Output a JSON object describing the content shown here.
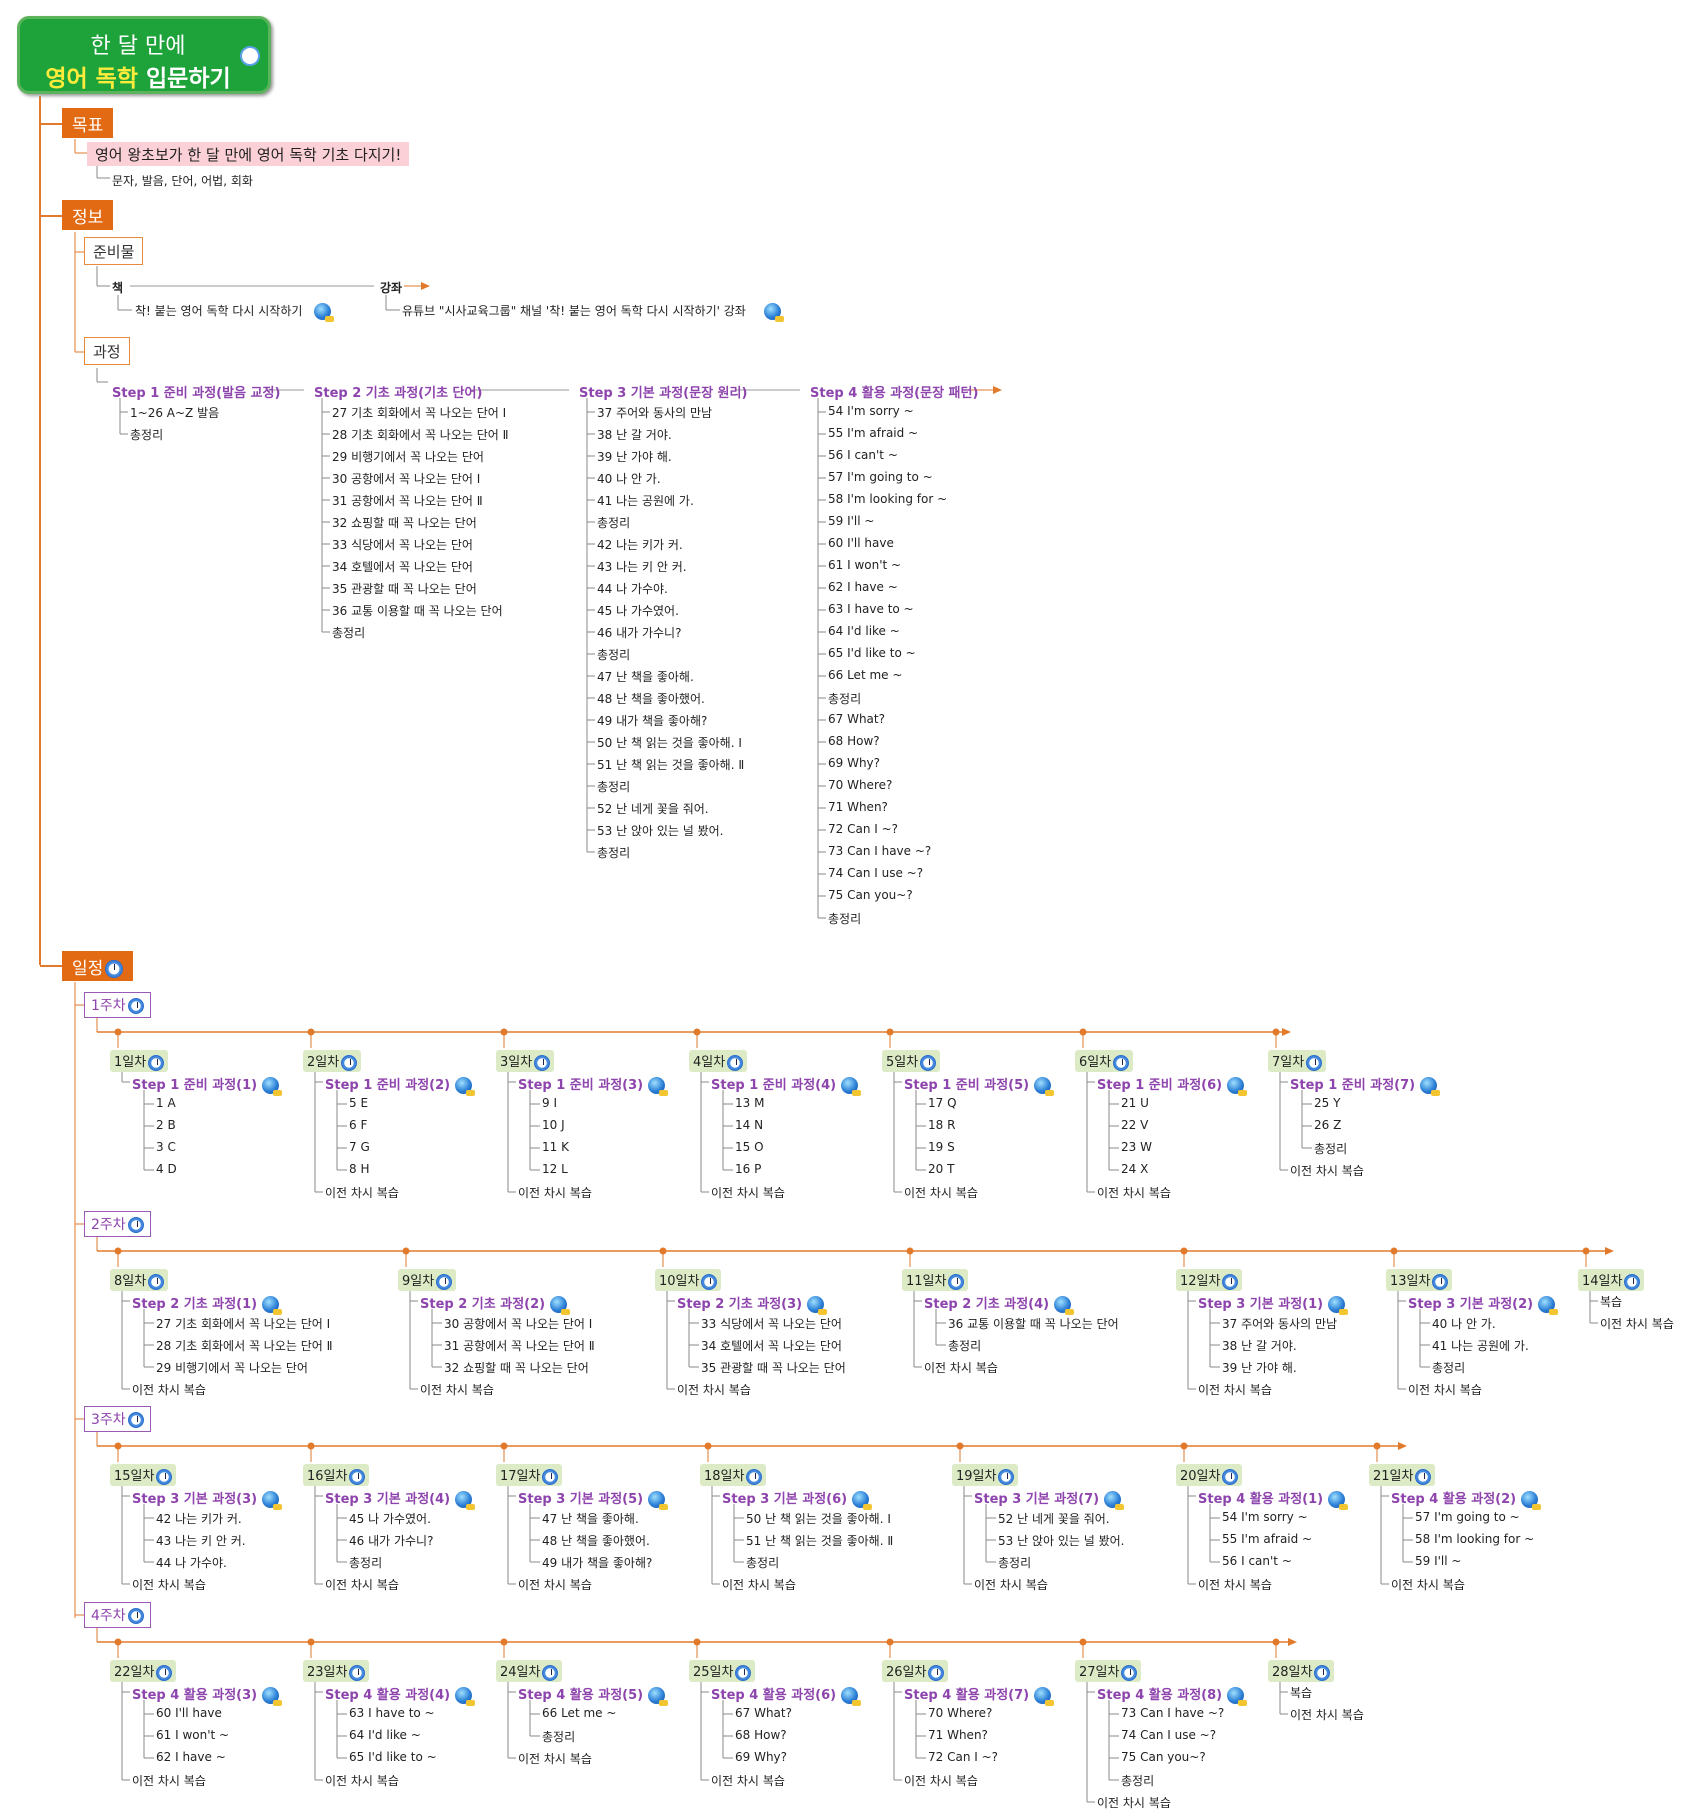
{
  "title": {
    "line1": "한 달 만에",
    "line2a": "영어 독학",
    "line2b": "입문하기"
  },
  "goal": {
    "label": "목표",
    "text": "영어 왕초보가 한 달 만에 영어 독학 기초 다지기!",
    "detail": "문자, 발음, 단어, 어법, 회화"
  },
  "info": {
    "label": "정보",
    "materials": {
      "label": "준비물",
      "book": "책",
      "book_title": "착! 붙는 영어 독학 다시 시작하기",
      "lecture": "강좌",
      "lecture_text": "유튜브 \"시사교육그룹\" 채널 '착! 붙는 영어 독학 다시 시작하기' 강좌"
    },
    "course": {
      "label": "과정",
      "steps": [
        {
          "title": "Step 1 준비 과정(발음 교정)",
          "items": [
            "1~26 A~Z 발음",
            "총정리"
          ]
        },
        {
          "title": "Step 2 기초 과정(기초 단어)",
          "items": [
            "27 기초 회화에서 꼭 나오는 단어 Ⅰ",
            "28 기초 회화에서 꼭 나오는 단어 Ⅱ",
            "29 비행기에서 꼭 나오는 단어",
            "30 공항에서 꼭 나오는 단어 Ⅰ",
            "31 공항에서 꼭 나오는 단어 Ⅱ",
            "32 쇼핑할 때 꼭 나오는 단어",
            "33 식당에서 꼭 나오는 단어",
            "34 호텔에서 꼭 나오는 단어",
            "35 관광할 때 꼭 나오는 단어",
            "36 교통 이용할 때 꼭 나오는 단어",
            "총정리"
          ]
        },
        {
          "title": "Step 3 기본 과정(문장 원리)",
          "items": [
            "37 주어와 동사의 만남",
            "38 난 갈 거야.",
            "39 난 가야 해.",
            "40 나 안 가.",
            "41 나는 공원에 가.",
            "총정리",
            "42 나는 키가 커.",
            "43 나는 키 안 커.",
            "44 나 가수야.",
            "45 나 가수였어.",
            "46 내가 가수니?",
            "총정리",
            "47 난 책을 좋아해.",
            "48 난 책을 좋아했어.",
            "49 내가 책을 좋아해?",
            "50 난 책 읽는 것을 좋아해. Ⅰ",
            "51 난 책 읽는 것을 좋아해. Ⅱ",
            "총정리",
            "52 난 네게 꽃을 줘어.",
            "53 난 앉아 있는 널 봤어.",
            "총정리"
          ]
        },
        {
          "title": "Step 4 활용 과정(문장 패턴)",
          "items": [
            "54 I'm sorry ~",
            "55 I'm afraid ~",
            "56 I can't ~",
            "57 I'm going to ~",
            "58 I'm looking for ~",
            "59 I'll ~",
            "60 I'll have",
            "61 I won't ~",
            "62 I have ~",
            "63 I have to ~",
            "64 I'd like ~",
            "65 I'd like to ~",
            "66 Let me ~",
            "총정리",
            "67 What?",
            "68 How?",
            "69 Why?",
            "70 Where?",
            "71 When?",
            "72 Can I ~?",
            "73 Can I have ~?",
            "74 Can I use ~?",
            "75 Can you~?",
            "총정리"
          ]
        }
      ]
    }
  },
  "schedule": {
    "label": "일정",
    "weeks": [
      {
        "label": "1주차",
        "days": [
          {
            "label": "1일차",
            "step": "Step 1 준비 과정(1)",
            "items": [
              "1 A",
              "2 B",
              "3 C",
              "4 D"
            ]
          },
          {
            "label": "2일차",
            "step": "Step 1 준비 과정(2)",
            "items": [
              "5 E",
              "6 F",
              "7 G",
              "8 H"
            ],
            "review": "이전 차시 복습"
          },
          {
            "label": "3일차",
            "step": "Step 1 준비 과정(3)",
            "items": [
              "9 I",
              "10 J",
              "11 K",
              "12 L"
            ],
            "review": "이전 차시 복습"
          },
          {
            "label": "4일차",
            "step": "Step 1 준비 과정(4)",
            "items": [
              "13 M",
              "14 N",
              "15 O",
              "16 P"
            ],
            "review": "이전 차시 복습"
          },
          {
            "label": "5일차",
            "step": "Step 1 준비 과정(5)",
            "items": [
              "17 Q",
              "18 R",
              "19 S",
              "20 T"
            ],
            "review": "이전 차시 복습"
          },
          {
            "label": "6일차",
            "step": "Step 1 준비 과정(6)",
            "items": [
              "21 U",
              "22 V",
              "23 W",
              "24 X"
            ],
            "review": "이전 차시 복습"
          },
          {
            "label": "7일차",
            "step": "Step 1 준비 과정(7)",
            "items": [
              "25 Y",
              "26 Z",
              "총정리"
            ],
            "review": "이전 차시 복습"
          }
        ]
      },
      {
        "label": "2주차",
        "days": [
          {
            "label": "8일차",
            "step": "Step 2 기초 과정(1)",
            "items": [
              "27 기초 회화에서 꼭 나오는 단어 Ⅰ",
              "28 기초 회화에서 꼭 나오는 단어 Ⅱ",
              "29 비행기에서 꼭 나오는 단어"
            ],
            "review": "이전 차시 복습"
          },
          {
            "label": "9일차",
            "step": "Step 2 기초 과정(2)",
            "items": [
              "30 공항에서 꼭 나오는 단어 Ⅰ",
              "31 공항에서 꼭 나오는 단어 Ⅱ",
              "32 쇼핑할 때 꼭 나오는 단어"
            ],
            "review": "이전 차시 복습"
          },
          {
            "label": "10일차",
            "step": "Step 2 기초 과정(3)",
            "items": [
              "33 식당에서 꼭 나오는 단어",
              "34 호텔에서 꼭 나오는 단어",
              "35 관광할 때 꼭 나오는 단어"
            ],
            "review": "이전 차시 복습"
          },
          {
            "label": "11일차",
            "step": "Step 2 기초 과정(4)",
            "items": [
              "36 교통 이용할 때 꼭 나오는 단어",
              "총정리"
            ],
            "review": "이전 차시 복습"
          },
          {
            "label": "12일차",
            "step": "Step 3 기본 과정(1)",
            "items": [
              "37 주어와 동사의 만남",
              "38 난 갈 거야.",
              "39 난 가야 해."
            ],
            "review": "이전 차시 복습"
          },
          {
            "label": "13일차",
            "step": "Step 3 기본 과정(2)",
            "items": [
              "40 나 안 가.",
              "41 나는 공원에 가.",
              "총정리"
            ],
            "review": "이전 차시 복습"
          },
          {
            "label": "14일차",
            "plain": [
              "복습",
              "이전 차시 복습"
            ]
          }
        ]
      },
      {
        "label": "3주차",
        "days": [
          {
            "label": "15일차",
            "step": "Step 3 기본 과정(3)",
            "items": [
              "42 나는 키가 커.",
              "43 나는 키 안 커.",
              "44 나 가수야."
            ],
            "review": "이전 차시 복습"
          },
          {
            "label": "16일차",
            "step": "Step 3 기본 과정(4)",
            "items": [
              "45 나 가수였어.",
              "46 내가 가수니?",
              "총정리"
            ],
            "review": "이전 차시 복습"
          },
          {
            "label": "17일차",
            "step": "Step 3 기본 과정(5)",
            "items": [
              "47 난 책을 좋아해.",
              "48 난 책을 좋아했어.",
              "49 내가 책을 좋아해?"
            ],
            "review": "이전 차시 복습"
          },
          {
            "label": "18일차",
            "step": "Step 3 기본 과정(6)",
            "items": [
              "50 난 책 읽는 것을 좋아해. Ⅰ",
              "51 난 책 읽는 것을 좋아해. Ⅱ",
              "총정리"
            ],
            "review": "이전 차시 복습"
          },
          {
            "label": "19일차",
            "step": "Step 3 기본 과정(7)",
            "items": [
              "52 난 네게 꽃을 줘어.",
              "53 난 앉아 있는 널 봤어.",
              "총정리"
            ],
            "review": "이전 차시 복습"
          },
          {
            "label": "20일차",
            "step": "Step 4 활용 과정(1)",
            "items": [
              "54 I'm sorry ~",
              "55 I'm afraid ~",
              "56 I can't ~"
            ],
            "review": "이전 차시 복습"
          },
          {
            "label": "21일차",
            "step": "Step 4 활용 과정(2)",
            "items": [
              "57 I'm going to ~",
              "58 I'm looking for ~",
              "59 I'll ~"
            ],
            "review": "이전 차시 복습"
          }
        ]
      },
      {
        "label": "4주차",
        "days": [
          {
            "label": "22일차",
            "step": "Step 4 활용 과정(3)",
            "items": [
              "60 I'll have",
              "61 I won't ~",
              "62 I have ~"
            ],
            "review": "이전 차시 복습"
          },
          {
            "label": "23일차",
            "step": "Step 4 활용 과정(4)",
            "items": [
              "63 I have to ~",
              "64 I'd like ~",
              "65 I'd like to ~"
            ],
            "review": "이전 차시 복습"
          },
          {
            "label": "24일차",
            "step": "Step 4 활용 과정(5)",
            "items": [
              "66 Let me ~",
              "총정리"
            ],
            "review": "이전 차시 복습"
          },
          {
            "label": "25일차",
            "step": "Step 4 활용 과정(6)",
            "items": [
              "67 What?",
              "68 How?",
              "69 Why?"
            ],
            "review": "이전 차시 복습"
          },
          {
            "label": "26일차",
            "step": "Step 4 활용 과정(7)",
            "items": [
              "70 Where?",
              "71 When?",
              "72 Can I ~?"
            ],
            "review": "이전 차시 복습"
          },
          {
            "label": "27일차",
            "step": "Step 4 활용 과정(8)",
            "items": [
              "73 Can I have ~?",
              "74 Can I use ~?",
              "75 Can you~?",
              "총정리"
            ],
            "review": "이전 차시 복습"
          },
          {
            "label": "28일차",
            "plain": [
              "복습",
              "이전 차시 복습"
            ]
          }
        ]
      }
    ]
  },
  "colors": {
    "orange": "#e26a12",
    "green": "#1ea33b",
    "purple": "#8e44ad",
    "day_bg": "#dcebc5",
    "goal_bg": "#fbd0d6"
  },
  "icons": {
    "title": "clock-icon",
    "link": "globe-link-icon"
  }
}
